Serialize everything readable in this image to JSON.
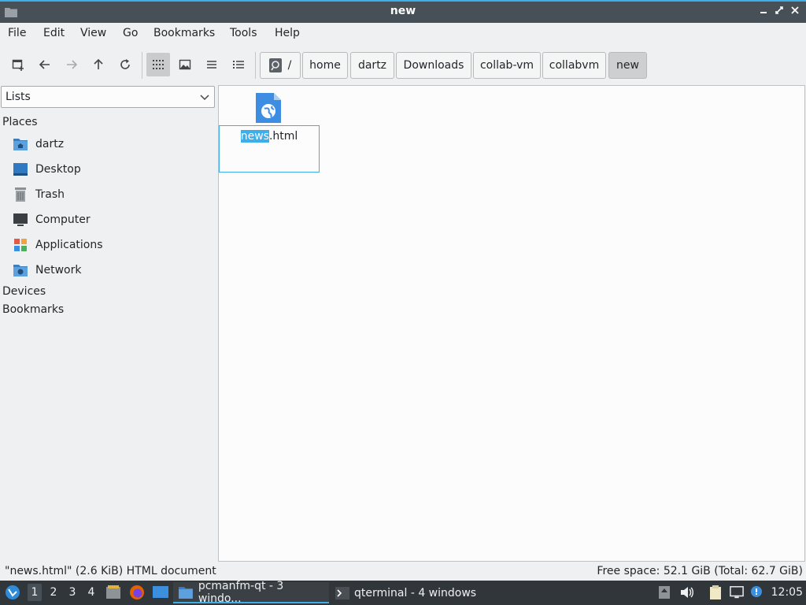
{
  "window": {
    "title": "new"
  },
  "menu": [
    "File",
    "Edit",
    "View",
    "Go",
    "Bookmarks",
    "Tools",
    "Help"
  ],
  "breadcrumb": {
    "root": "/",
    "items": [
      "home",
      "dartz",
      "Downloads",
      "collab-vm",
      "collabvm",
      "new"
    ]
  },
  "sidebar": {
    "combo_value": "Lists",
    "places_title": "Places",
    "places": [
      "dartz",
      "Desktop",
      "Trash",
      "Computer",
      "Applications",
      "Network"
    ],
    "devices_title": "Devices",
    "bookmarks_title": "Bookmarks"
  },
  "file": {
    "name_selected": "news",
    "name_rest": ".html"
  },
  "status": {
    "left": "\"news.html\" (2.6 KiB) HTML document",
    "right": "Free space: 52.1 GiB (Total: 62.7 GiB)"
  },
  "taskbar": {
    "workspaces": [
      "1",
      "2",
      "3",
      "4"
    ],
    "tasks": [
      "pcmanfm-qt - 3 windo...",
      "qterminal - 4 windows"
    ],
    "clock": "12:05"
  },
  "colors": {
    "accent": "#3daee9",
    "titlebar": "#475057",
    "taskbar": "#31363b"
  }
}
